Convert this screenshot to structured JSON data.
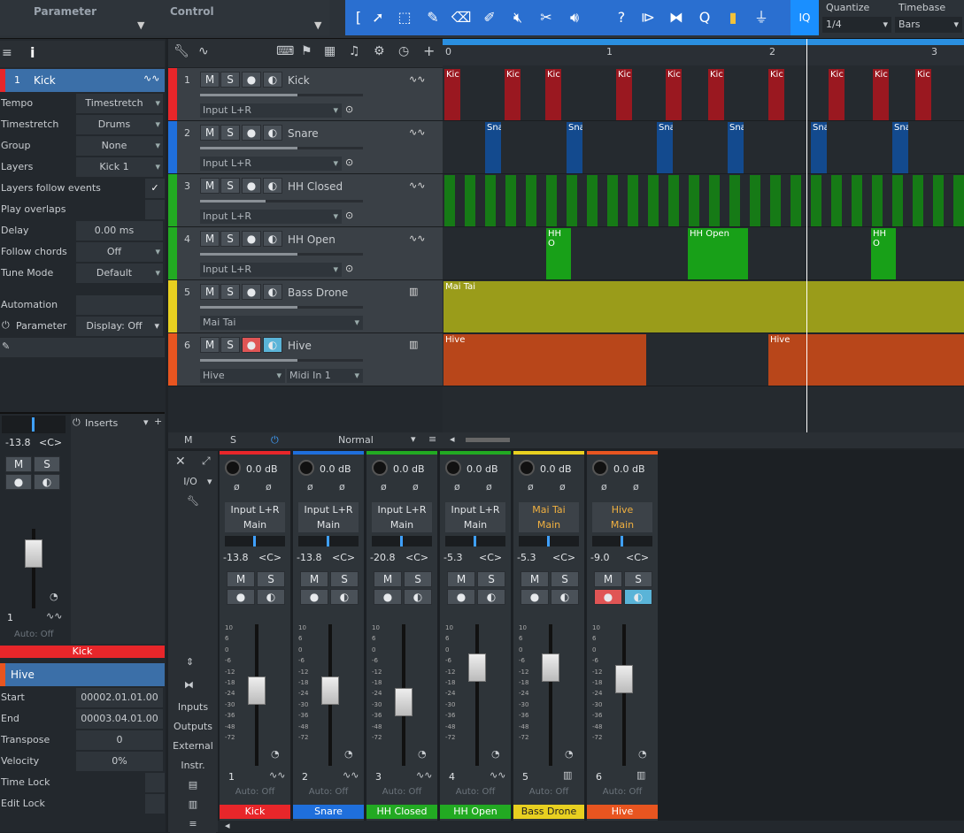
{
  "topbar": {
    "param_label": "Parameter",
    "control_label": "Control",
    "quantize_label": "Quantize",
    "quantize_value": "1/4",
    "timebase_label": "Timebase",
    "timebase_value": "Bars",
    "iq_label": "IQ",
    "help": "?",
    "q": "Q"
  },
  "inspector": {
    "track_num": "1",
    "track_name": "Kick",
    "rows": [
      {
        "k": "Tempo",
        "v": "Timestretch"
      },
      {
        "k": "Timestretch",
        "v": "Drums"
      },
      {
        "k": "Group",
        "v": "None"
      },
      {
        "k": "Layers",
        "v": "Kick 1"
      },
      {
        "k": "Layers follow events",
        "v": ""
      },
      {
        "k": "Play overlaps",
        "v": ""
      },
      {
        "k": "Delay",
        "v": "0.00 ms"
      },
      {
        "k": "Follow chords",
        "v": "Off"
      },
      {
        "k": "Tune Mode",
        "v": "Default"
      }
    ],
    "automation": "Automation",
    "parameter": "Parameter",
    "display": "Display: Off",
    "mini_pan": "-13.8",
    "mini_panc": "<C>",
    "inserts": "Inserts",
    "mini_num": "1",
    "mini_auto": "Auto: Off",
    "mini_name": "Kick",
    "event_name": "Hive",
    "event_rows": [
      {
        "k": "Start",
        "v": "00002.01.01.00"
      },
      {
        "k": "End",
        "v": "00003.04.01.00"
      },
      {
        "k": "Transpose",
        "v": "0"
      },
      {
        "k": "Velocity",
        "v": "0%"
      },
      {
        "k": "Time Lock",
        "v": ""
      },
      {
        "k": "Edit Lock",
        "v": ""
      }
    ]
  },
  "tracks": [
    {
      "num": "1",
      "name": "Kick",
      "color": "#e8262a",
      "input": "Input L+R",
      "fader": 0.6
    },
    {
      "num": "2",
      "name": "Snare",
      "color": "#1f6fdc",
      "input": "Input L+R",
      "fader": 0.6
    },
    {
      "num": "3",
      "name": "HH Closed",
      "color": "#22aa22",
      "input": "Input L+R",
      "fader": 0.4
    },
    {
      "num": "4",
      "name": "HH Open",
      "color": "#22aa22",
      "input": "Input L+R",
      "fader": 0.6
    },
    {
      "num": "5",
      "name": "Bass Drone",
      "color": "#e8d020",
      "input": "Mai Tai",
      "fader": 0.6
    },
    {
      "num": "6",
      "name": "Hive",
      "color": "#e85520",
      "input": "Hive",
      "input2": "Midi In 1",
      "fader": 0.6
    }
  ],
  "track_footer": {
    "m": "M",
    "s": "S",
    "mode": "Normal"
  },
  "ruler": {
    "marks": [
      "0",
      "1",
      "2",
      "3"
    ]
  },
  "events": {
    "kick": "Kic",
    "snare": "Sna",
    "hh_open": "HH O",
    "hh_open_full": "HH Open",
    "bass": "Mai Tai",
    "hive": "Hive"
  },
  "mixer": {
    "side": [
      "I/O",
      "Inputs",
      "Outputs",
      "External",
      "Instr."
    ],
    "strips": [
      {
        "num": "1",
        "name": "Kick",
        "color": "#e8262a",
        "db": "0.0 dB",
        "in": "Input L+R",
        "out": "Main",
        "pan": "-13.8",
        "panc": "<C>",
        "auto": "Auto: Off",
        "fader": 0.55
      },
      {
        "num": "2",
        "name": "Snare",
        "color": "#1f6fdc",
        "db": "0.0 dB",
        "in": "Input L+R",
        "out": "Main",
        "pan": "-13.8",
        "panc": "<C>",
        "auto": "Auto: Off",
        "fader": 0.55
      },
      {
        "num": "3",
        "name": "HH Closed",
        "color": "#22aa22",
        "db": "0.0 dB",
        "in": "Input L+R",
        "out": "Main",
        "pan": "-20.8",
        "panc": "<C>",
        "auto": "Auto: Off",
        "fader": 0.45
      },
      {
        "num": "4",
        "name": "HH Open",
        "color": "#22aa22",
        "db": "0.0 dB",
        "in": "Input L+R",
        "out": "Main",
        "pan": "-5.3",
        "panc": "<C>",
        "auto": "Auto: Off",
        "fader": 0.75
      },
      {
        "num": "5",
        "name": "Bass Drone",
        "color": "#e8d020",
        "db": "0.0 dB",
        "in": "Mai Tai",
        "out": "Main",
        "pan": "-5.3",
        "panc": "<C>",
        "auto": "Auto: Off",
        "fader": 0.75
      },
      {
        "num": "6",
        "name": "Hive",
        "color": "#e85520",
        "db": "0.0 dB",
        "in": "Hive",
        "out": "Main",
        "pan": "-9.0",
        "panc": "<C>",
        "auto": "Auto: Off",
        "fader": 0.65
      }
    ],
    "scale": [
      "10",
      "6",
      "0",
      "-6",
      "-12",
      "-18",
      "-24",
      "-30",
      "-36",
      "-48",
      "-72"
    ]
  }
}
